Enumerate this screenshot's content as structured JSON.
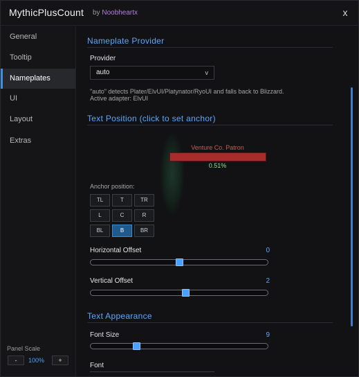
{
  "window": {
    "title": "MythicPlusCount",
    "by": "by",
    "author": "Noobheartx",
    "close_label": "x"
  },
  "sidebar": {
    "items": [
      {
        "label": "General"
      },
      {
        "label": "Tooltip"
      },
      {
        "label": "Nameplates"
      },
      {
        "label": "UI"
      },
      {
        "label": "Layout"
      },
      {
        "label": "Extras"
      }
    ],
    "active_index": 2,
    "panel_scale": {
      "label": "Panel Scale",
      "minus": "-",
      "value": "100%",
      "plus": "+"
    }
  },
  "nameplate_provider": {
    "section_title": "Nameplate Provider",
    "provider_label": "Provider",
    "provider_value": "auto",
    "dropdown_chevron": "v",
    "help_line1": "\"auto\" detects Plater/ElvUI/Platynator/RyoUI and falls back to Blizzard.",
    "help_line2": "Active adapter: ElvUI"
  },
  "text_position": {
    "section_title": "Text Position (click to set anchor)",
    "preview": {
      "unit_name": "Venture Co. Patron",
      "count_text": "0.51%"
    },
    "anchor_label": "Anchor position:",
    "anchors": [
      {
        "label": "TL"
      },
      {
        "label": "T"
      },
      {
        "label": "TR"
      },
      {
        "label": "L"
      },
      {
        "label": "C"
      },
      {
        "label": "R"
      },
      {
        "label": "BL"
      },
      {
        "label": "B"
      },
      {
        "label": "BR"
      }
    ],
    "selected_anchor": "B",
    "horizontal_offset": {
      "label": "Horizontal Offset",
      "value": "0",
      "fraction": 0.5
    },
    "vertical_offset": {
      "label": "Vertical Offset",
      "value": "2",
      "fraction": 0.54
    }
  },
  "text_appearance": {
    "section_title": "Text Appearance",
    "font_size": {
      "label": "Font Size",
      "value": "9",
      "fraction": 0.25
    },
    "font_label": "Font"
  },
  "colors": {
    "accent": "#4aa0ff",
    "author": "#b87be0",
    "nameplate_bar": "#a82c2c",
    "unit_name": "#e05050",
    "count_text": "#8fe08f"
  }
}
